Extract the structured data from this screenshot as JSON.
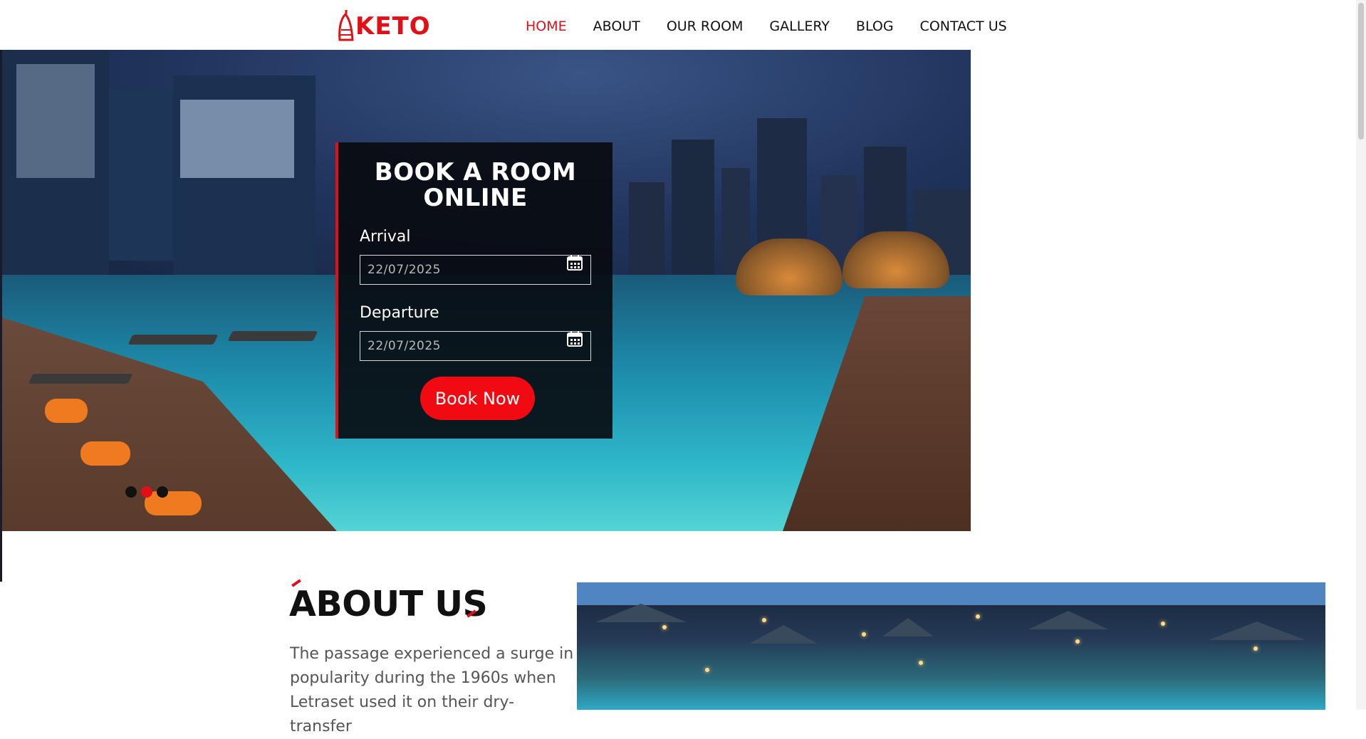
{
  "brand": {
    "logo_text": "KETO",
    "accent_color": "#e21016"
  },
  "nav": {
    "items": [
      {
        "label": "HOME",
        "active": true
      },
      {
        "label": "ABOUT",
        "active": false
      },
      {
        "label": "OUR ROOM",
        "active": false
      },
      {
        "label": "GALLERY",
        "active": false
      },
      {
        "label": "BLOG",
        "active": false
      },
      {
        "label": "CONTACT US",
        "active": false
      }
    ]
  },
  "booking": {
    "title": "BOOK A ROOM\nONLINE",
    "arrival_label": "Arrival",
    "arrival_value": "22/07/2025",
    "departure_label": "Departure",
    "departure_value": "22/07/2025",
    "submit_label": "Book Now",
    "calendar_icon": "calendar-icon"
  },
  "hero": {
    "slides": 3,
    "active_slide": 2
  },
  "about": {
    "title": "ABOUT US",
    "text": "The passage experienced a surge in popularity during the 1960s when Letraset used it on their dry-transfer"
  }
}
